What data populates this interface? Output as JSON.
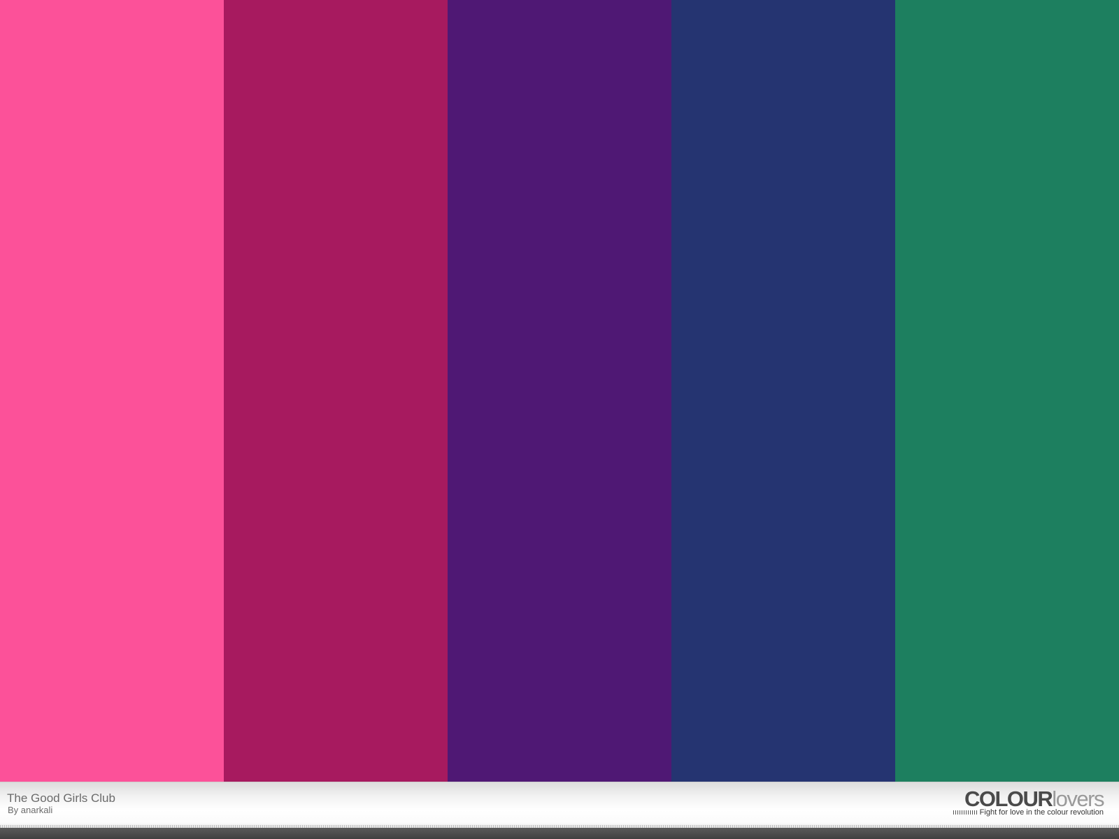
{
  "palette": {
    "title": "The Good Girls Club",
    "byline": "By anarkali",
    "colors": [
      "#FC5199",
      "#A71A5F",
      "#4F1874",
      "#253471",
      "#1D7F5F"
    ]
  },
  "brand": {
    "logo_strong": "COLOUR",
    "logo_light": "lovers",
    "tagline": "Fight for love in the colour revolution"
  }
}
